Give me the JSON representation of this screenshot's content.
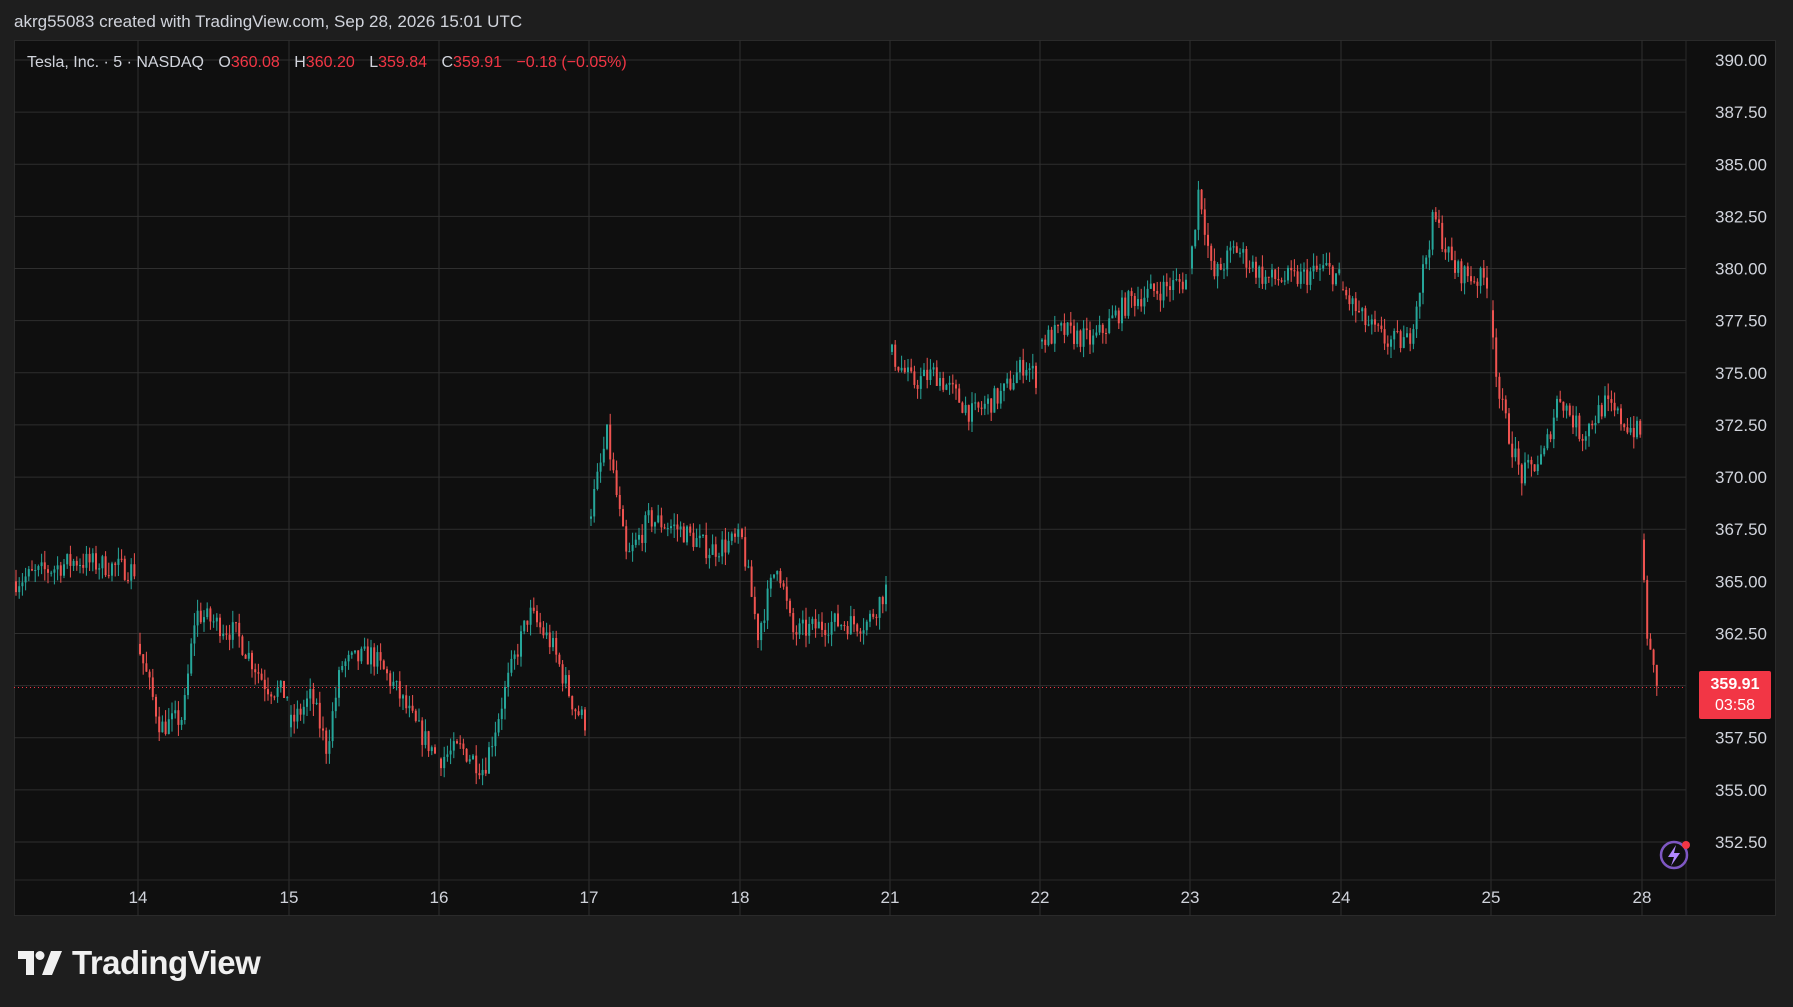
{
  "header": {
    "attribution": "akrg55083 created with TradingView.com, Sep 28, 2026 15:01 UTC"
  },
  "legend": {
    "symbol": "Tesla, Inc. · 5 · NASDAQ",
    "open_label": "O",
    "open": "360.08",
    "high_label": "H",
    "high": "360.20",
    "low_label": "L",
    "low": "359.84",
    "close_label": "C",
    "close": "359.91",
    "change": "−0.18 (−0.05%)"
  },
  "price_tag": {
    "price": "359.91",
    "countdown": "03:58"
  },
  "brand": {
    "name": "TradingView"
  },
  "colors": {
    "up": "#26a69a",
    "down": "#ef5350",
    "accent": "#f23645",
    "grid": "#2f2f2f",
    "background": "#0f0f0f"
  },
  "icons": {
    "logo": "tradingview-logo-icon",
    "alert": "lightning-alert-icon"
  },
  "chart_data": {
    "type": "candlestick",
    "timeframe": "5",
    "x_ticks": [
      "14",
      "15",
      "16",
      "17",
      "18",
      "21",
      "22",
      "23",
      "24",
      "25",
      "28"
    ],
    "y_ticks": [
      "352.50",
      "355.00",
      "357.50",
      "360.00",
      "362.50",
      "365.00",
      "367.50",
      "370.00",
      "372.50",
      "375.00",
      "377.50",
      "380.00",
      "382.50",
      "385.00",
      "387.50",
      "390.00"
    ],
    "ylim": [
      350.0,
      391.0
    ],
    "last_price": 359.91,
    "series": [
      {
        "day": "13",
        "points": [
          [
            0.0,
            365.0
          ],
          [
            0.5,
            366.0
          ],
          [
            1.0,
            365.5
          ]
        ]
      },
      {
        "day": "14",
        "points": [
          [
            0.0,
            362.0
          ],
          [
            0.15,
            358.0
          ],
          [
            0.3,
            358.5
          ],
          [
            0.38,
            363.5
          ],
          [
            0.65,
            362.5
          ],
          [
            0.85,
            360.0
          ],
          [
            1.0,
            359.5
          ]
        ]
      },
      {
        "day": "15",
        "points": [
          [
            0.0,
            358.0
          ],
          [
            0.15,
            359.5
          ],
          [
            0.25,
            357.0
          ],
          [
            0.35,
            361.0
          ],
          [
            0.55,
            361.5
          ],
          [
            0.7,
            360.0
          ],
          [
            0.85,
            358.0
          ],
          [
            1.0,
            356.5
          ]
        ]
      },
      {
        "day": "16",
        "points": [
          [
            0.0,
            356.5
          ],
          [
            0.15,
            357.0
          ],
          [
            0.3,
            356.0
          ],
          [
            0.45,
            360.0
          ],
          [
            0.6,
            363.5
          ],
          [
            0.75,
            362.0
          ],
          [
            0.9,
            359.0
          ],
          [
            1.0,
            358.0
          ]
        ]
      },
      {
        "day": "17",
        "points": [
          [
            0.0,
            368.0
          ],
          [
            0.12,
            372.0
          ],
          [
            0.25,
            366.0
          ],
          [
            0.4,
            368.0
          ],
          [
            0.6,
            367.5
          ],
          [
            0.8,
            366.5
          ],
          [
            1.0,
            367.0
          ]
        ]
      },
      {
        "day": "18",
        "points": [
          [
            0.0,
            367.5
          ],
          [
            0.12,
            362.5
          ],
          [
            0.25,
            366.0
          ],
          [
            0.35,
            362.5
          ],
          [
            0.6,
            363.0
          ],
          [
            0.85,
            363.0
          ],
          [
            1.0,
            365.0
          ]
        ]
      },
      {
        "day": "21",
        "points": [
          [
            0.0,
            376.0
          ],
          [
            0.15,
            374.5
          ],
          [
            0.3,
            375.0
          ],
          [
            0.55,
            373.0
          ],
          [
            0.75,
            374.0
          ],
          [
            0.9,
            375.5
          ],
          [
            1.0,
            374.5
          ]
        ]
      },
      {
        "day": "22",
        "points": [
          [
            0.0,
            376.5
          ],
          [
            0.15,
            377.0
          ],
          [
            0.35,
            376.5
          ],
          [
            0.6,
            378.5
          ],
          [
            0.8,
            379.0
          ],
          [
            1.0,
            379.5
          ]
        ]
      },
      {
        "day": "23",
        "points": [
          [
            0.0,
            380.0
          ],
          [
            0.06,
            384.0
          ],
          [
            0.15,
            379.5
          ],
          [
            0.3,
            381.0
          ],
          [
            0.5,
            379.5
          ],
          [
            0.7,
            379.5
          ],
          [
            0.9,
            380.0
          ],
          [
            1.0,
            379.5
          ]
        ]
      },
      {
        "day": "24",
        "points": [
          [
            0.0,
            379.0
          ],
          [
            0.15,
            377.5
          ],
          [
            0.3,
            376.5
          ],
          [
            0.45,
            376.5
          ],
          [
            0.55,
            380.0
          ],
          [
            0.62,
            382.5
          ],
          [
            0.75,
            380.0
          ],
          [
            0.9,
            379.5
          ],
          [
            1.0,
            379.5
          ]
        ]
      },
      {
        "day": "25",
        "points": [
          [
            0.0,
            378.0
          ],
          [
            0.05,
            374.0
          ],
          [
            0.12,
            372.0
          ],
          [
            0.2,
            370.0
          ],
          [
            0.35,
            371.0
          ],
          [
            0.45,
            374.0
          ],
          [
            0.6,
            372.0
          ],
          [
            0.75,
            373.5
          ],
          [
            0.9,
            372.5
          ],
          [
            1.0,
            372.0
          ]
        ]
      },
      {
        "day": "28",
        "points": [
          [
            0.0,
            367.0
          ],
          [
            0.1,
            363.0
          ],
          [
            0.25,
            361.0
          ],
          [
            0.45,
            359.9
          ]
        ]
      }
    ]
  }
}
